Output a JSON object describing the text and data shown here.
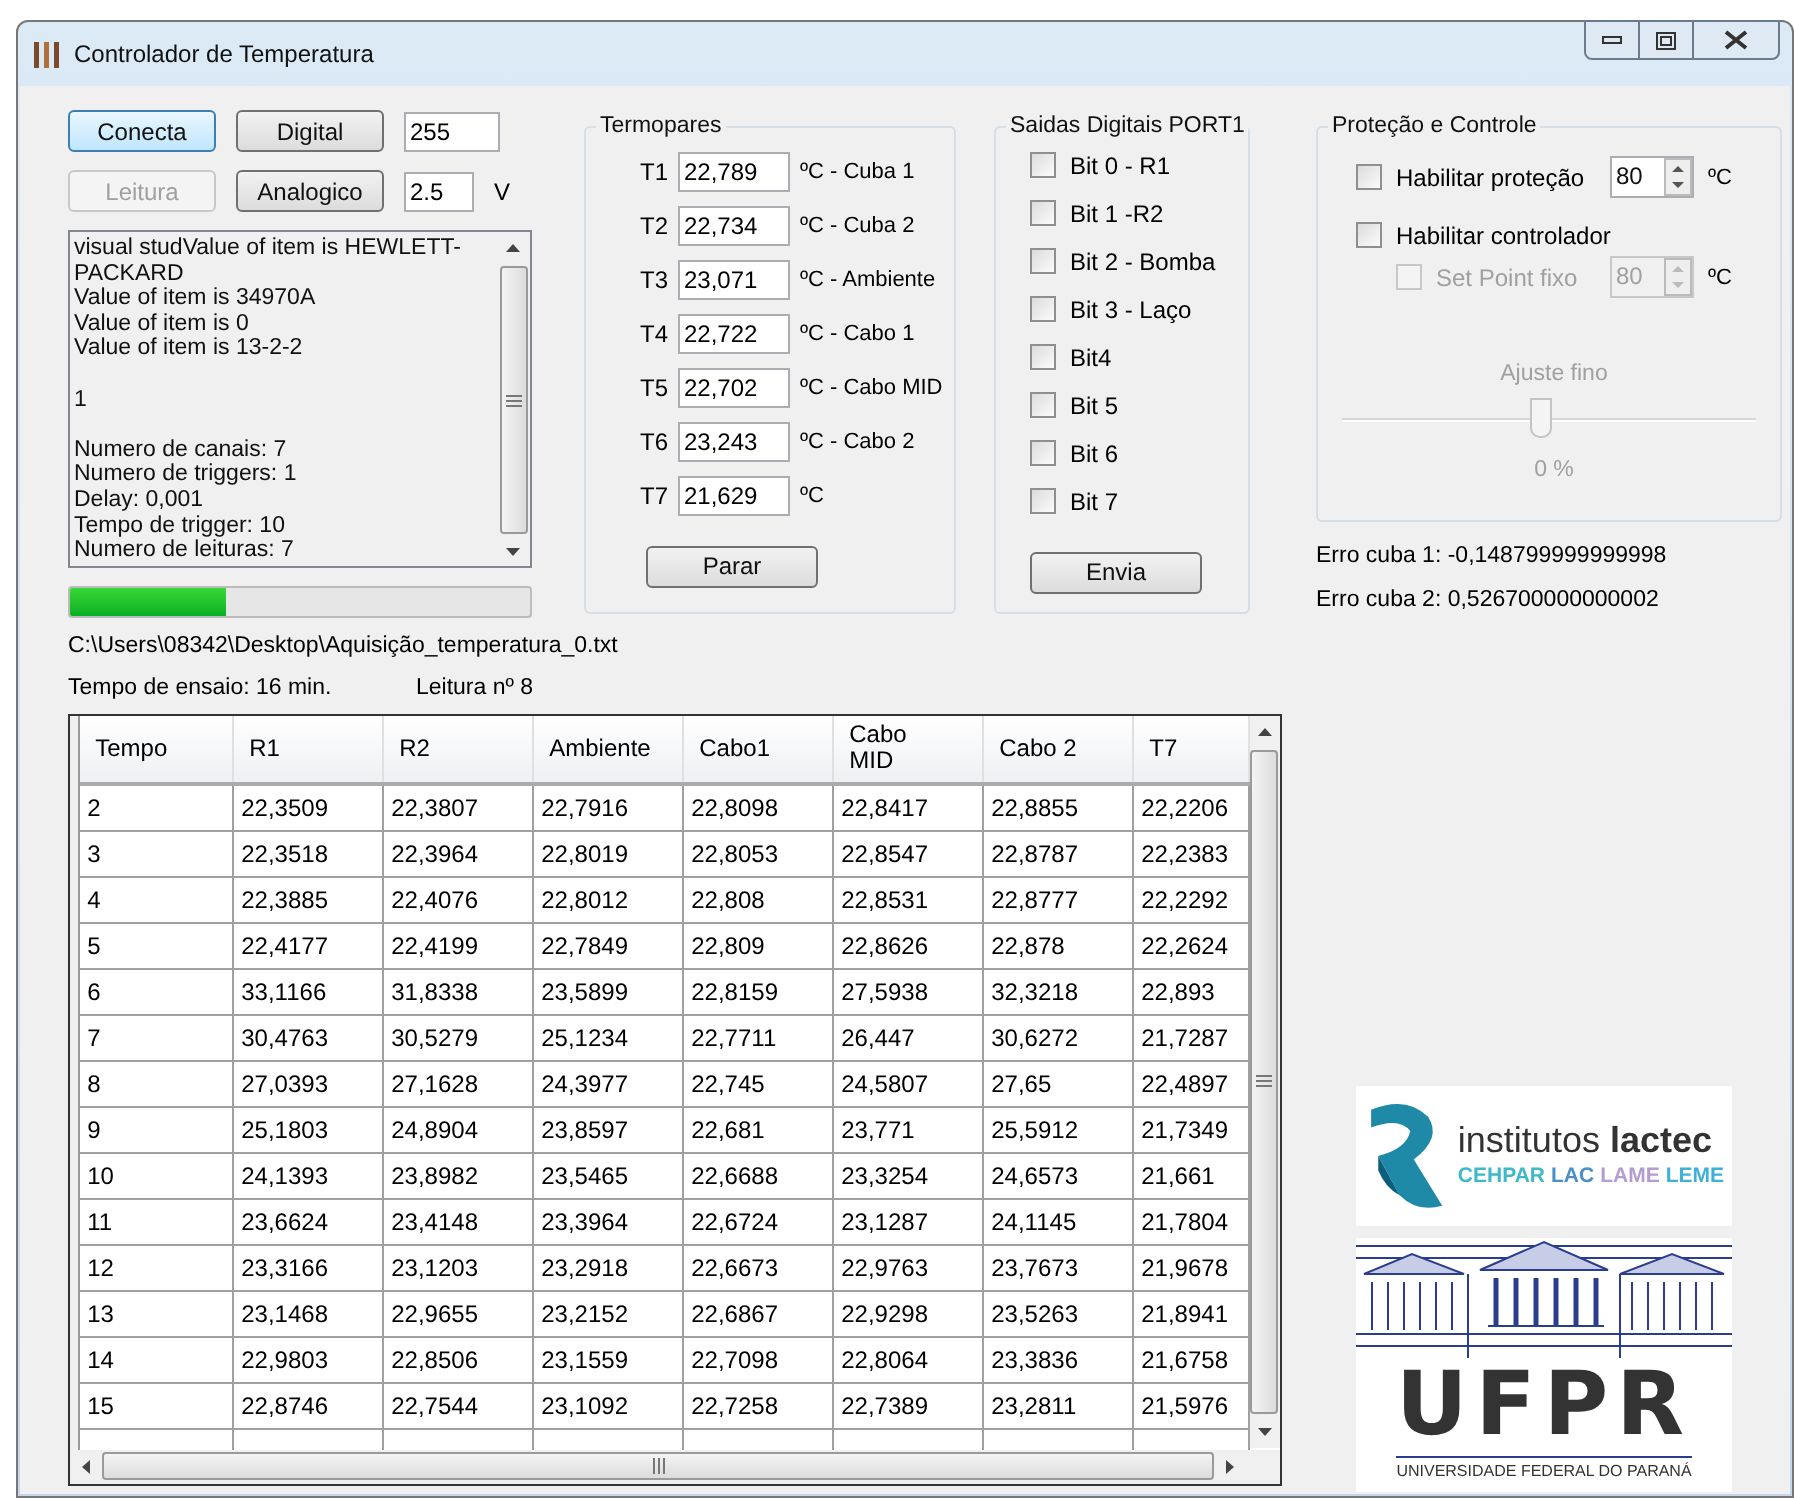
{
  "window": {
    "title": "Controlador de Temperatura"
  },
  "connection": {
    "buttons": [
      {
        "label": "Conecta",
        "disabled": false,
        "focused": true
      },
      {
        "label": "Digital",
        "disabled": false,
        "focused": false
      },
      {
        "label": "Leitura",
        "disabled": true,
        "focused": false
      },
      {
        "label": "Analogico",
        "disabled": false,
        "focused": false
      }
    ],
    "digital_value": "255",
    "analog_value": "2.5",
    "analog_unit": "V"
  },
  "log": [
    {
      "text": "visual studValue of item is HEWLETT-PACKARD",
      "space_before": false
    },
    {
      "text": "Value of item is 34970A",
      "space_before": false
    },
    {
      "text": "Value of item is 0",
      "space_before": false
    },
    {
      "text": "Value of item is 13-2-2",
      "space_before": false
    },
    {
      "text": "1",
      "space_before": true
    },
    {
      "text": "Numero de canais: 7",
      "space_before": true
    },
    {
      "text": "Numero de triggers: 1",
      "space_before": false
    },
    {
      "text": "Delay: 0,001",
      "space_before": false
    },
    {
      "text": "Tempo de trigger: 10",
      "space_before": false
    },
    {
      "text": "Numero de leituras: 7",
      "space_before": false
    }
  ],
  "progress": {
    "level": 0.34
  },
  "file_path": "C:\\Users\\08342\\Desktop\\Aquisição_temperatura_0.txt",
  "test_time": "Tempo de ensaio: 16 min.",
  "reading_no": "Leitura nº 8",
  "termopares": {
    "title": "Termopares",
    "rows": [
      {
        "label": "T1",
        "value": "22,789",
        "unit": "ºC - Cuba 1"
      },
      {
        "label": "T2",
        "value": "22,734",
        "unit": "ºC - Cuba 2"
      },
      {
        "label": "T3",
        "value": "23,071",
        "unit": "ºC - Ambiente"
      },
      {
        "label": "T4",
        "value": "22,722",
        "unit": "ºC - Cabo 1"
      },
      {
        "label": "T5",
        "value": "22,702",
        "unit": "ºC - Cabo MID"
      },
      {
        "label": "T6",
        "value": "23,243",
        "unit": "ºC - Cabo 2"
      },
      {
        "label": "T7",
        "value": "21,629",
        "unit": "ºC"
      }
    ],
    "button": "Parar"
  },
  "outputs": {
    "title": "Saidas Digitais PORT1",
    "bits": [
      {
        "label": "Bit 0 - R1",
        "checked": false
      },
      {
        "label": "Bit 1 -R2",
        "checked": false
      },
      {
        "label": "Bit 2 - Bomba",
        "checked": false
      },
      {
        "label": "Bit 3 - Laço",
        "checked": false
      },
      {
        "label": "Bit4",
        "checked": false
      },
      {
        "label": "Bit 5",
        "checked": false
      },
      {
        "label": "Bit 6",
        "checked": false
      },
      {
        "label": "Bit 7",
        "checked": false
      }
    ],
    "button": "Envia"
  },
  "protection": {
    "title": "Proteção e Controle",
    "enable_protection": {
      "label": "Habilitar proteção",
      "checked": false,
      "value": "80",
      "unit": "ºC",
      "disabled": false
    },
    "enable_controller": {
      "label": "Habilitar controlador",
      "checked": false
    },
    "setpoint": {
      "label": "Set Point fixo",
      "checked": false,
      "value": "80",
      "unit": "ºC",
      "disabled": true
    },
    "fine_adjust": {
      "label": "Ajuste fino",
      "level": 0.48,
      "reading": "0 %",
      "disabled": true
    }
  },
  "errors": [
    "Erro cuba 1: -0,148799999999998",
    "Erro cuba 2: 0,526700000000002"
  ],
  "table": {
    "columns": [
      "Tempo",
      "R1",
      "R2",
      "Ambiente",
      "Cabo1",
      "Cabo\nMID",
      "Cabo 2",
      "T7"
    ],
    "rows": [
      [
        "2",
        "22,3509",
        "22,3807",
        "22,7916",
        "22,8098",
        "22,8417",
        "22,8855",
        "22,2206"
      ],
      [
        "3",
        "22,3518",
        "22,3964",
        "22,8019",
        "22,8053",
        "22,8547",
        "22,8787",
        "22,2383"
      ],
      [
        "4",
        "22,3885",
        "22,4076",
        "22,8012",
        "22,808",
        "22,8531",
        "22,8777",
        "22,2292"
      ],
      [
        "5",
        "22,4177",
        "22,4199",
        "22,7849",
        "22,809",
        "22,8626",
        "22,878",
        "22,2624"
      ],
      [
        "6",
        "33,1166",
        "31,8338",
        "23,5899",
        "22,8159",
        "27,5938",
        "32,3218",
        "22,893"
      ],
      [
        "7",
        "30,4763",
        "30,5279",
        "25,1234",
        "22,7711",
        "26,447",
        "30,6272",
        "21,7287"
      ],
      [
        "8",
        "27,0393",
        "27,1628",
        "24,3977",
        "22,745",
        "24,5807",
        "27,65",
        "22,4897"
      ],
      [
        "9",
        "25,1803",
        "24,8904",
        "23,8597",
        "22,681",
        "23,771",
        "25,5912",
        "21,7349"
      ],
      [
        "10",
        "24,1393",
        "23,8982",
        "23,5465",
        "22,6688",
        "23,3254",
        "24,6573",
        "21,661"
      ],
      [
        "11",
        "23,6624",
        "23,4148",
        "23,3964",
        "22,6724",
        "23,1287",
        "24,1145",
        "21,7804"
      ],
      [
        "12",
        "23,3166",
        "23,1203",
        "23,2918",
        "22,6673",
        "22,9763",
        "23,7673",
        "21,9678"
      ],
      [
        "13",
        "23,1468",
        "22,9655",
        "23,2152",
        "22,6867",
        "22,9298",
        "23,5263",
        "21,8941"
      ],
      [
        "14",
        "22,9803",
        "22,8506",
        "23,1559",
        "22,7098",
        "22,8064",
        "23,3836",
        "21,6758"
      ],
      [
        "15",
        "22,8746",
        "22,7544",
        "23,1092",
        "22,7258",
        "22,7389",
        "23,2811",
        "21,5976"
      ]
    ]
  },
  "logos": {
    "lactec": {
      "name_light": "institutos",
      "name_bold": "lactec",
      "units": [
        {
          "text": "CEHPAR",
          "color": "#3fb8c8"
        },
        {
          "text": "LAC",
          "color": "#4a8fc9"
        },
        {
          "text": "LAME",
          "color": "#b59bd0"
        },
        {
          "text": "LEME",
          "color": "#3fb0d8"
        }
      ]
    },
    "ufpr": {
      "acronym": "UFPR",
      "name": "UNIVERSIDADE FEDERAL DO PARANÁ"
    }
  }
}
